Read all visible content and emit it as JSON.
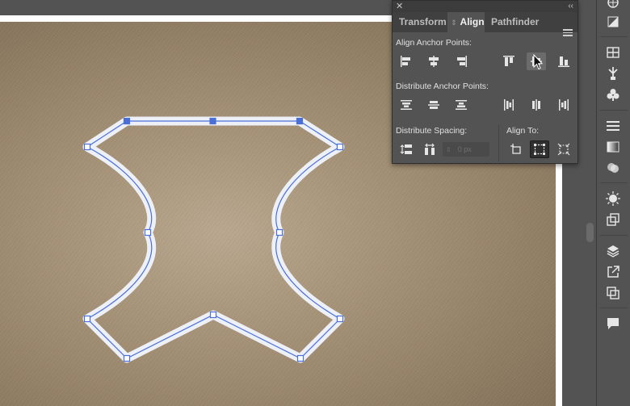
{
  "panel": {
    "tabs": [
      {
        "label": "Transform",
        "active": false
      },
      {
        "label": "Align",
        "active": true
      },
      {
        "label": "Pathfinder",
        "active": false
      }
    ],
    "sections": {
      "align_anchor_points": "Align Anchor Points:",
      "distribute_anchor_points": "Distribute Anchor Points:",
      "distribute_spacing": "Distribute Spacing:",
      "align_to": "Align To:"
    },
    "spacing_value": "0 px",
    "hovered_button": "vertical-align-center"
  },
  "colors": {
    "panel_bg": "#535353",
    "selection_blue": "#4a6fd6",
    "canvas_texture": "#a59277",
    "shape_fill_stroke": "#e9ecf7"
  },
  "toolbar_icons": [
    "libraries-icon",
    "gradient-swatch-icon",
    "swatches-icon",
    "brushes-icon",
    "symbols-icon",
    "stroke-icon",
    "gradient-icon",
    "transparency-icon",
    "appearance-icon",
    "graphic-styles-icon",
    "layers-icon",
    "asset-export-icon",
    "artboards-icon",
    "comments-icon"
  ]
}
